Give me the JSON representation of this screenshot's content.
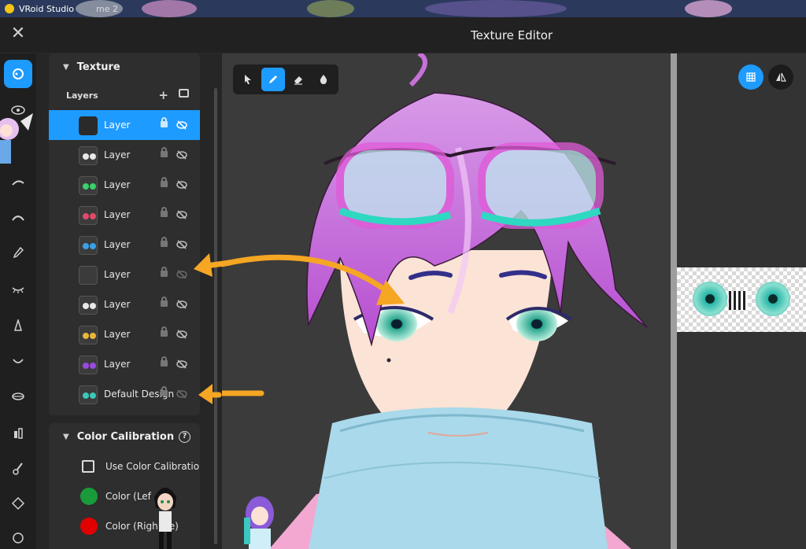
{
  "window": {
    "app_title": "VRoid Studio",
    "tab_fragment": "me 2"
  },
  "header": {
    "title": "Texture Editor"
  },
  "texture_panel": {
    "section_title": "Texture",
    "layers_label": "Layers",
    "layers": [
      {
        "name": "Layer",
        "selected": true,
        "thumb": "dark",
        "visibility": "hidden"
      },
      {
        "name": "Layer",
        "selected": false,
        "thumb": "white-eyes",
        "visibility": "hidden"
      },
      {
        "name": "Layer",
        "selected": false,
        "thumb": "green-eyes",
        "visibility": "hidden"
      },
      {
        "name": "Layer",
        "selected": false,
        "thumb": "red-eyes",
        "visibility": "hidden"
      },
      {
        "name": "Layer",
        "selected": false,
        "thumb": "blue-eyes",
        "visibility": "hidden"
      },
      {
        "name": "Layer",
        "selected": false,
        "thumb": "empty",
        "visibility": "hidden-dim"
      },
      {
        "name": "Layer",
        "selected": false,
        "thumb": "white-eyes",
        "visibility": "hidden"
      },
      {
        "name": "Layer",
        "selected": false,
        "thumb": "gold-eyes",
        "visibility": "hidden"
      },
      {
        "name": "Layer",
        "selected": false,
        "thumb": "purple-eyes",
        "visibility": "hidden"
      },
      {
        "name": "Default Design",
        "selected": false,
        "thumb": "teal-eyes",
        "visibility": "hidden-dim"
      }
    ]
  },
  "color_calibration": {
    "section_title": "Color Calibration",
    "use_label": "Use Color Calibratio",
    "left_label": "Color (Lef",
    "right_label": "Color (Righ",
    "right_label_tail": "e)",
    "left_color": "#1a9b3a",
    "right_color": "#e00000"
  },
  "toolbar": {
    "tools": [
      {
        "name": "select",
        "active": false
      },
      {
        "name": "pen",
        "active": true
      },
      {
        "name": "eraser",
        "active": false
      },
      {
        "name": "fill",
        "active": false
      }
    ]
  },
  "colors": {
    "accent": "#1e9bff",
    "annotation_arrow": "#f5a623",
    "hair": "#d46fe0",
    "scarf": "#a8d8e8"
  }
}
